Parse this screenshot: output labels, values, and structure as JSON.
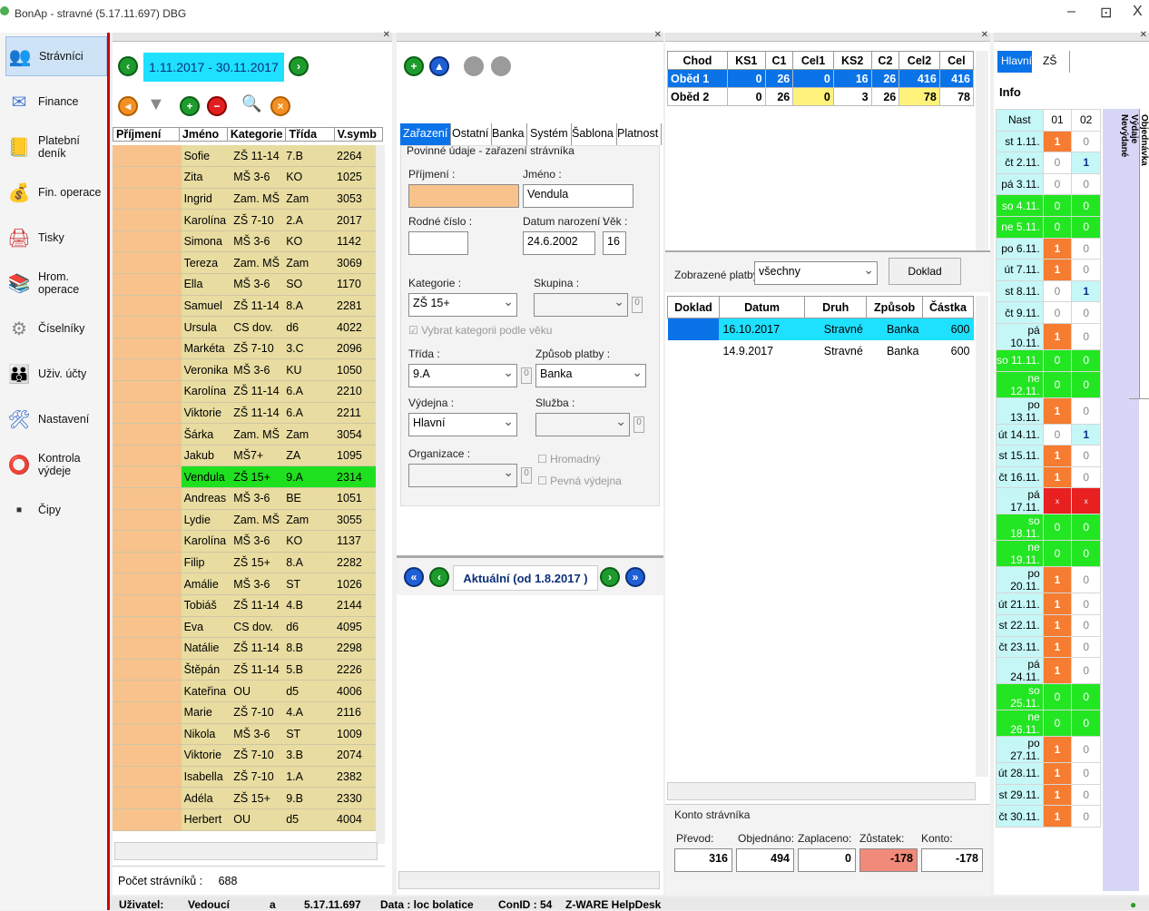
{
  "window": {
    "title": "BonAp - stravné (5.17.11.697) DBG",
    "minimize": "–",
    "maximize": "⊡",
    "close": "X"
  },
  "sidebar": {
    "items": [
      {
        "label": "Strávníci",
        "icon": "people-icon"
      },
      {
        "label": "Finance",
        "icon": "finance-icon"
      },
      {
        "label": "Platební deník",
        "icon": "journal-icon"
      },
      {
        "label": "Fin. operace",
        "icon": "money-bag-icon"
      },
      {
        "label": "Tisky",
        "icon": "printer-icon"
      },
      {
        "label": "Hrom. operace",
        "icon": "books-icon"
      },
      {
        "label": "Číselníky",
        "icon": "gear-icon"
      },
      {
        "label": "Uživ. účty",
        "icon": "users-icon"
      },
      {
        "label": "Nastavení",
        "icon": "settings-icon"
      },
      {
        "label": "Kontrola výdeje",
        "icon": "lifebuoy-icon"
      },
      {
        "label": "Čipy",
        "icon": "chip-icon"
      }
    ]
  },
  "list": {
    "date_range": "1.11.2017 - 30.11.2017",
    "columns": [
      "Příjmení",
      "Jméno",
      "Kategorie",
      "Třída",
      "V.symb"
    ],
    "rows": [
      [
        "",
        "Sofie",
        "ZŠ 11-14",
        "7.B",
        "2264"
      ],
      [
        "",
        "Zita",
        "MŠ 3-6",
        "KO",
        "1025"
      ],
      [
        "",
        "Ingrid",
        "Zam. MŠ",
        "Zam",
        "3053"
      ],
      [
        "",
        "Karolína",
        "ZŠ 7-10",
        "2.A",
        "2017"
      ],
      [
        "",
        "Simona",
        "MŠ 3-6",
        "KO",
        "1142"
      ],
      [
        "",
        "Tereza",
        "Zam. MŠ",
        "Zam",
        "3069"
      ],
      [
        "",
        "Ella",
        "MŠ 3-6",
        "SO",
        "1170"
      ],
      [
        "",
        "Samuel",
        "ZŠ 11-14",
        "8.A",
        "2281"
      ],
      [
        "",
        "Ursula",
        "CS dov.",
        "d6",
        "4022"
      ],
      [
        "",
        "Markéta",
        "ZŠ 7-10",
        "3.C",
        "2096"
      ],
      [
        "",
        "Veronika",
        "MŠ 3-6",
        "KU",
        "1050"
      ],
      [
        "",
        "Karolína",
        "ZŠ 11-14",
        "6.A",
        "2210"
      ],
      [
        "",
        "Viktorie",
        "ZŠ 11-14",
        "6.A",
        "2211"
      ],
      [
        "",
        "Šárka",
        "Zam. MŠ",
        "Zam",
        "3054"
      ],
      [
        "",
        "Jakub",
        "MŠ7+",
        "ZA",
        "1095"
      ],
      [
        "",
        "Vendula",
        "ZŠ 15+",
        "9.A",
        "2314"
      ],
      [
        "",
        "Andreas",
        "MŠ 3-6",
        "BE",
        "1051"
      ],
      [
        "",
        "Lydie",
        "Zam. MŠ",
        "Zam",
        "3055"
      ],
      [
        "",
        "Karolína",
        "MŠ 3-6",
        "KO",
        "1137"
      ],
      [
        "",
        "Filip",
        "ZŠ 15+",
        "8.A",
        "2282"
      ],
      [
        "",
        "Amálie",
        "MŠ 3-6",
        "ST",
        "1026"
      ],
      [
        "",
        "Tobiáš",
        "ZŠ 11-14",
        "4.B",
        "2144"
      ],
      [
        "",
        "Eva",
        "CS dov.",
        "d6",
        "4095"
      ],
      [
        "",
        "Natálie",
        "ZŠ 11-14",
        "8.B",
        "2298"
      ],
      [
        "",
        "Štěpán",
        "ZŠ 11-14",
        "5.B",
        "2226"
      ],
      [
        "",
        "Kateřina",
        "OU",
        "d5",
        "4006"
      ],
      [
        "",
        "Marie",
        "ZŠ 7-10",
        "4.A",
        "2116"
      ],
      [
        "",
        "Nikola",
        "MŠ 3-6",
        "ST",
        "1009"
      ],
      [
        "",
        "Viktorie",
        "ZŠ 7-10",
        "3.B",
        "2074"
      ],
      [
        "",
        "Isabella",
        "ZŠ 7-10",
        "1.A",
        "2382"
      ],
      [
        "",
        "Adéla",
        "ZŠ 15+",
        "9.B",
        "2330"
      ],
      [
        "",
        "Herbert",
        "OU",
        "d5",
        "4004"
      ]
    ],
    "selected_index": 15,
    "count_label": "Počet strávníků :",
    "count_value": "688"
  },
  "detail": {
    "tabs": [
      "Zařazení",
      "Ostatní",
      "Banka",
      "Systém",
      "Šablona",
      "Platnost"
    ],
    "section_title": "Povinné údaje - zařazení strávníka",
    "surname_label": "Příjmení :",
    "surname_value": "",
    "name_label": "Jméno :",
    "name_value": "Vendula",
    "birthno_label": "Rodné číslo :",
    "birthno_value": "",
    "birthdate_label": "Datum narození :",
    "birthdate_value": "24.6.2002",
    "age_label": "Věk :",
    "age_value": "16",
    "category_label": "Kategorie :",
    "category_value": "ZŠ 15+",
    "group_label": "Skupina :",
    "group_value": "",
    "auto_category_label": "Vybrat kategorii podle věku",
    "class_label": "Třída :",
    "class_value": "9.A",
    "payment_label": "Způsob platby :",
    "payment_value": "Banka",
    "outlet_label": "Výdejna :",
    "outlet_value": "Hlavní",
    "service_label": "Služba :",
    "service_value": "",
    "org_label": "Organizace :",
    "org_value": "",
    "bulk_label": "Hromadný",
    "fixed_outlet_label": "Pevná výdejna",
    "zero": "0",
    "current_label": "Aktuální (od 1.8.2017 )"
  },
  "meals": {
    "columns": [
      "Chod",
      "KS1",
      "C1",
      "Cel1",
      "KS2",
      "C2",
      "Cel2",
      "Cel"
    ],
    "rows": [
      [
        "Oběd 1",
        "0",
        "26",
        "0",
        "16",
        "26",
        "416",
        "416"
      ],
      [
        "Oběd 2",
        "0",
        "26",
        "0",
        "3",
        "26",
        "78",
        "78"
      ]
    ]
  },
  "payments": {
    "filter_label": "Zobrazené platby :",
    "filter_value": "všechny",
    "receipt_button": "Doklad",
    "columns": [
      "Doklad",
      "Datum",
      "Druh",
      "Způsob",
      "Částka"
    ],
    "rows": [
      [
        "",
        "16.10.2017",
        "Stravné",
        "Banka",
        "600"
      ],
      [
        "",
        "14.9.2017",
        "Stravné",
        "Banka",
        "600"
      ]
    ]
  },
  "account": {
    "title": "Konto strávníka",
    "labels": [
      "Převod:",
      "Objednáno:",
      "Zaplaceno:",
      "Zůstatek:",
      "Konto:"
    ],
    "values": [
      "316",
      "494",
      "0",
      "-178",
      "-178"
    ]
  },
  "calendar": {
    "tabs": [
      "Hlavní",
      "ZŠ"
    ],
    "info_label": "Info",
    "columns": [
      "Nast",
      "01",
      "02"
    ],
    "side_tabs": [
      "Objednávka",
      "Výdaje",
      "Nevýdané"
    ],
    "rows": [
      [
        "st 1.11.",
        "1",
        "0"
      ],
      [
        "čt 2.11.",
        "0",
        "1"
      ],
      [
        "pá 3.11.",
        "0",
        "0"
      ],
      [
        "so 4.11.",
        "0",
        "0"
      ],
      [
        "ne 5.11.",
        "0",
        "0"
      ],
      [
        "po 6.11.",
        "1",
        "0"
      ],
      [
        "út 7.11.",
        "1",
        "0"
      ],
      [
        "st 8.11.",
        "0",
        "1"
      ],
      [
        "čt 9.11.",
        "0",
        "0"
      ],
      [
        "pá 10.11.",
        "1",
        "0"
      ],
      [
        "so 11.11.",
        "0",
        "0"
      ],
      [
        "ne 12.11.",
        "0",
        "0"
      ],
      [
        "po 13.11.",
        "1",
        "0"
      ],
      [
        "út 14.11.",
        "0",
        "1"
      ],
      [
        "st 15.11.",
        "1",
        "0"
      ],
      [
        "čt 16.11.",
        "1",
        "0"
      ],
      [
        "pá 17.11.",
        "x",
        "x"
      ],
      [
        "so 18.11.",
        "0",
        "0"
      ],
      [
        "ne 19.11.",
        "0",
        "0"
      ],
      [
        "po 20.11.",
        "1",
        "0"
      ],
      [
        "út 21.11.",
        "1",
        "0"
      ],
      [
        "st 22.11.",
        "1",
        "0"
      ],
      [
        "čt 23.11.",
        "1",
        "0"
      ],
      [
        "pá 24.11.",
        "1",
        "0"
      ],
      [
        "so 25.11.",
        "0",
        "0"
      ],
      [
        "ne 26.11.",
        "0",
        "0"
      ],
      [
        "po 27.11.",
        "1",
        "0"
      ],
      [
        "út 28.11.",
        "1",
        "0"
      ],
      [
        "st 29.11.",
        "1",
        "0"
      ],
      [
        "čt 30.11.",
        "1",
        "0"
      ]
    ]
  },
  "status": {
    "user_label": "Uživatel:",
    "user_value": "Vedoucí",
    "a": "a",
    "version": "5.17.11.697",
    "data": "Data : loc bolatice",
    "conid": "ConID : 54",
    "helpdesk": "Z-WARE HelpDesk"
  },
  "colors": {
    "orange": "#f7c28b",
    "tan": "#e8dca0",
    "green": "#1fe01f",
    "blue": "#0a73e8",
    "cyan": "#c6f7f7",
    "cal_orange": "#f57c30",
    "cal_green": "#22e622",
    "cal_red": "#e82020",
    "lilac": "#d8d6f6"
  }
}
